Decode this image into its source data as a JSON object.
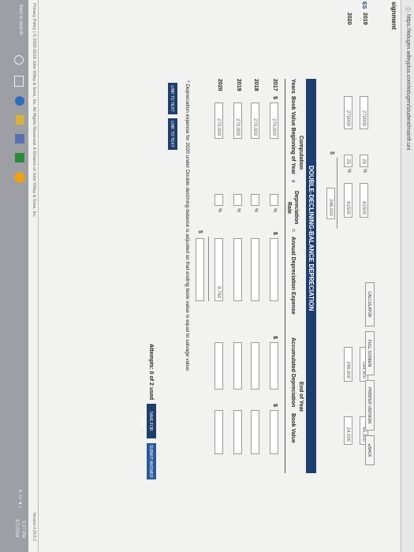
{
  "browser": {
    "url": "https://edugen.wileyplus.com/edugen/student/mainfr.uni"
  },
  "page": {
    "title": "signment",
    "side_label": "ES"
  },
  "toolbar": {
    "calculator": "CALCULATOR",
    "full_screen": "FULL SCREEN",
    "printer_version": "PRINTER VERSION",
    "back": "◂ BACK"
  },
  "top_rows": [
    {
      "year": "2019",
      "book_value": "270000",
      "rate": "25",
      "pct": "%",
      "expense": "61500",
      "accum": "184,500",
      "end_value": "85,500"
    },
    {
      "year": "2020",
      "book_value": "270000",
      "rate": "25",
      "pct": "%",
      "expense": "61500",
      "accum": "246,000",
      "end_value": "24,000"
    }
  ],
  "top_total": {
    "currency": "$",
    "value": "246,000"
  },
  "section_title": "DOUBLE-DECLINING-BALANCE DEPRECIATION",
  "headers": {
    "computation": "Computation",
    "end_of_year": "End of Year",
    "years": "Years",
    "book_value_begin": "Book Value Beginning of Year",
    "times": "x",
    "dep_rate": "Depreciation",
    "rate": "Rate",
    "equals": "=",
    "annual_expense": "Annual Depreciation Expense",
    "accum": "Accumulated Depreciation",
    "book_value": "Book Value"
  },
  "rows": [
    {
      "year": "2017",
      "currency": "$",
      "book_value": "270,000",
      "pct": "%",
      "expense_currency": "$",
      "expense": "",
      "accum_currency": "$",
      "accum": "",
      "bv_currency": "$",
      "bv": ""
    },
    {
      "year": "2018",
      "currency": "",
      "book_value": "270,000",
      "pct": "%",
      "expense_currency": "",
      "expense": "",
      "accum_currency": "",
      "accum": "",
      "bv_currency": "",
      "bv": ""
    },
    {
      "year": "2019",
      "currency": "",
      "book_value": "270,000",
      "pct": "%",
      "expense_currency": "",
      "expense": "",
      "accum_currency": "",
      "accum": "",
      "bv_currency": "",
      "bv": ""
    },
    {
      "year": "2020",
      "currency": "",
      "book_value": "270,000",
      "pct": "%",
      "expense_currency": "",
      "expense": "9,750",
      "accum_currency": "",
      "accum": "",
      "bv_currency": "",
      "bv": ""
    }
  ],
  "total": {
    "currency": "$",
    "value": ""
  },
  "footnote": "* Depreciation expense for 2020 under Double declining-balance is adjusted so that ending book value is equal to salvage value.",
  "link_buttons": [
    "LINK TO TEXT",
    "LINK TO TEXT"
  ],
  "attempts": "Attempts: 0 of 2 used",
  "actions": {
    "save": "SAVE FOR LATER",
    "submit": "SUBMIT ANSWER"
  },
  "footer": {
    "left": "Privacy Policy  |  © 2000-2018 John Wiley & Sons, Inc. All Rights Reserved. A Division of John Wiley & Sons, Inc.",
    "version": "Version 4.24.5.2"
  },
  "taskbar": {
    "search": "here to search",
    "time": "5:27 PM",
    "date": "4/7/2018"
  }
}
